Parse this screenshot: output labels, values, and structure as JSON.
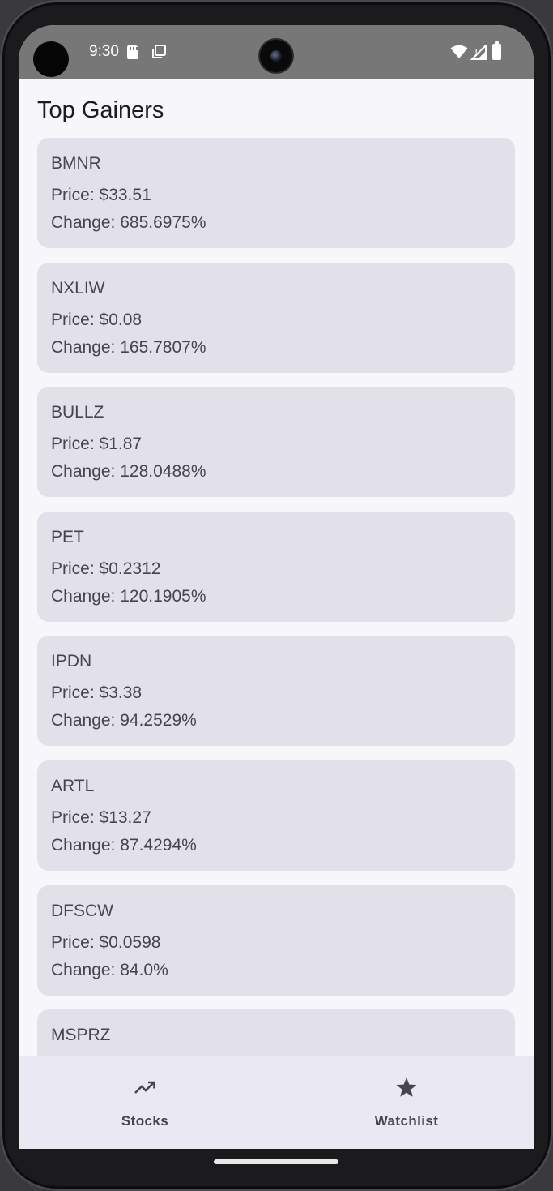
{
  "status_bar": {
    "time": "9:30"
  },
  "page": {
    "title": "Top Gainers"
  },
  "stocks": [
    {
      "symbol": "BMNR",
      "price": "Price: $33.51",
      "change": "Change: 685.6975%"
    },
    {
      "symbol": "NXLIW",
      "price": "Price: $0.08",
      "change": "Change: 165.7807%"
    },
    {
      "symbol": "BULLZ",
      "price": "Price: $1.87",
      "change": "Change: 128.0488%"
    },
    {
      "symbol": "PET",
      "price": "Price: $0.2312",
      "change": "Change: 120.1905%"
    },
    {
      "symbol": "IPDN",
      "price": "Price: $3.38",
      "change": "Change: 94.2529%"
    },
    {
      "symbol": "ARTL",
      "price": "Price: $13.27",
      "change": "Change: 87.4294%"
    },
    {
      "symbol": "DFSCW",
      "price": "Price: $0.0598",
      "change": "Change: 84.0%"
    },
    {
      "symbol": "MSPRZ",
      "price": "",
      "change": ""
    }
  ],
  "bottom_nav": {
    "items": [
      {
        "label": "Stocks",
        "icon": "trending-up-icon"
      },
      {
        "label": "Watchlist",
        "icon": "star-icon"
      }
    ]
  },
  "colors": {
    "status_bar": "#777777",
    "background": "#f7f6fb",
    "card": "#e2e1e9",
    "text": "#44464f",
    "nav_bar": "#eae9f3"
  }
}
